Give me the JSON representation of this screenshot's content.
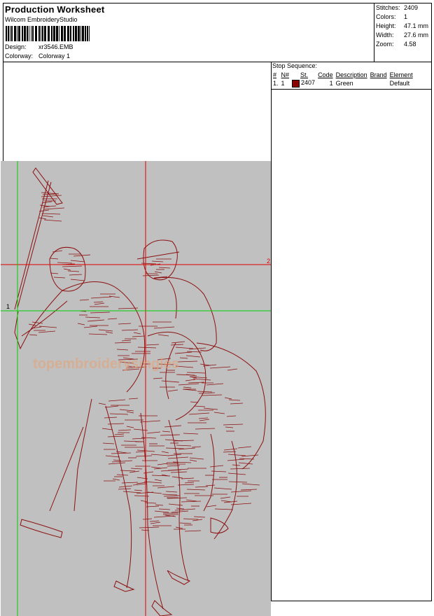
{
  "header": {
    "title": "Production Worksheet",
    "software": "Wilcom EmbroideryStudio",
    "design_label": "Design:",
    "design_value": "xr3546.EMB",
    "colorway_label": "Colorway:",
    "colorway_value": "Colorway 1"
  },
  "stats": [
    {
      "label": "Stitches:",
      "value": "2409"
    },
    {
      "label": "Colors:",
      "value": "1"
    },
    {
      "label": "Height:",
      "value": "47.1 mm"
    },
    {
      "label": "Width:",
      "value": "27.6 mm"
    },
    {
      "label": "Zoom:",
      "value": "4.58"
    }
  ],
  "stop_sequence": {
    "title": "Stop Sequence:",
    "columns": [
      "#",
      "N#",
      "St.",
      "Code",
      "Description",
      "Brand",
      "Element"
    ],
    "rows": [
      {
        "num": "1.",
        "n": "1",
        "swatch_color": "#8b0000",
        "st": "2407",
        "code": "1",
        "description": "Green",
        "brand": "",
        "element": "Default"
      }
    ]
  },
  "design": {
    "watermark": "topembroiderysingles",
    "guide_1_label": "1",
    "guide_2_label": "2",
    "thread_color": "#8b1010",
    "guide_red": "#e00000",
    "guide_green": "#00d000",
    "background": "#c0c0c0"
  }
}
